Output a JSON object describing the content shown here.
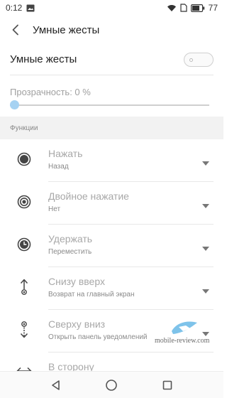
{
  "status_bar": {
    "time": "0:12",
    "battery": "77"
  },
  "header": {
    "title": "Умные жесты"
  },
  "toggle": {
    "label": "Умные жесты",
    "enabled": false
  },
  "opacity": {
    "label": "Прозрачность: 0 %",
    "value": 0
  },
  "section": {
    "title": "Функции"
  },
  "gestures": [
    {
      "title": "Нажать",
      "action": "Назад",
      "icon": "filled-circle-icon"
    },
    {
      "title": "Двойное нажатие",
      "action": "Нет",
      "icon": "double-circle-icon"
    },
    {
      "title": "Удержать",
      "action": "Переместить",
      "icon": "clock-circle-icon"
    },
    {
      "title": "Снизу вверх",
      "action": "Возврат на главный экран",
      "icon": "swipe-up-icon"
    },
    {
      "title": "Сверху вниз",
      "action": "Открыть панель уведомлений",
      "icon": "swipe-down-icon"
    },
    {
      "title": "В сторону",
      "action": "",
      "icon": "swipe-side-icon"
    }
  ],
  "watermark": {
    "text": "mobile-review.com"
  }
}
